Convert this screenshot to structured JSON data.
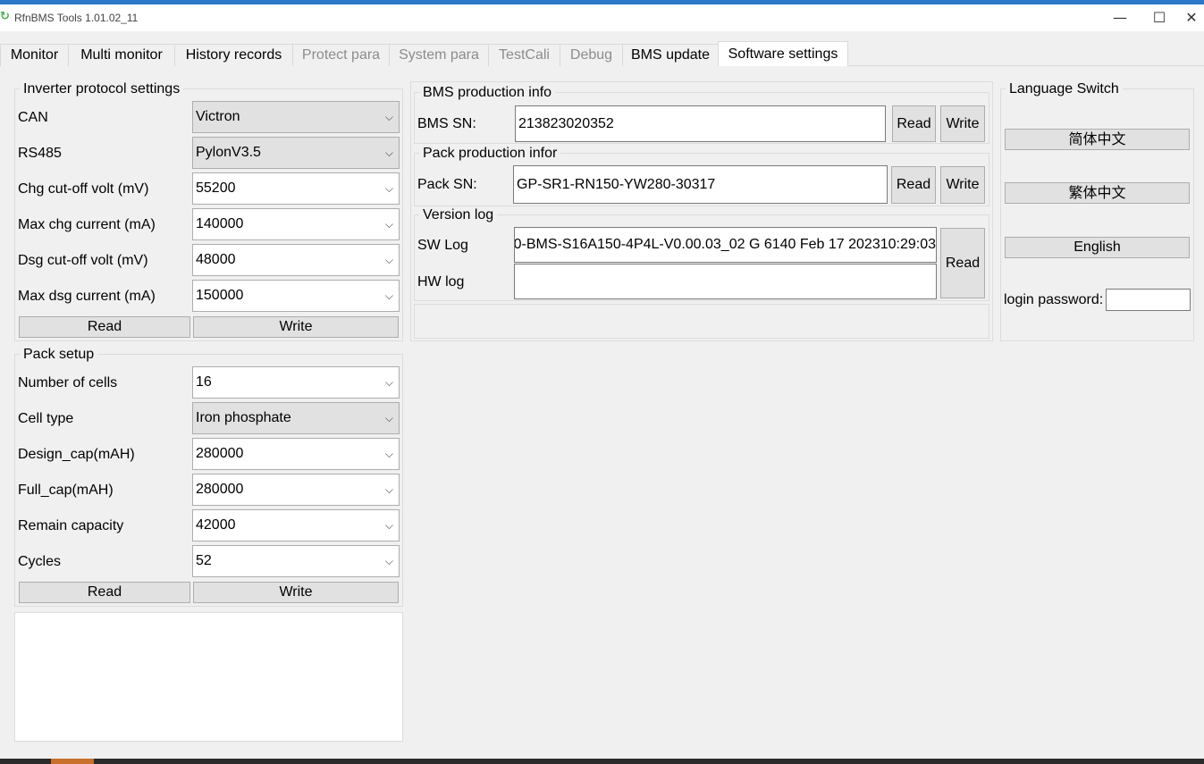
{
  "window": {
    "title": "RfnBMS Tools 1.01.02_11",
    "min": "—",
    "max": "☐",
    "close": "✕"
  },
  "tabs": [
    {
      "label": "Monitor",
      "state": "normal"
    },
    {
      "label": "Multi monitor",
      "state": "normal"
    },
    {
      "label": "History records",
      "state": "normal"
    },
    {
      "label": "Protect para",
      "state": "disabled"
    },
    {
      "label": "System para",
      "state": "disabled"
    },
    {
      "label": "TestCali",
      "state": "disabled"
    },
    {
      "label": "Debug",
      "state": "disabled"
    },
    {
      "label": "BMS update",
      "state": "normal"
    },
    {
      "label": "Software settings",
      "state": "active"
    }
  ],
  "inverter": {
    "title": "Inverter protocol settings",
    "rows": [
      {
        "label": "CAN",
        "value": "Victron"
      },
      {
        "label": "RS485",
        "value": "PylonV3.5"
      },
      {
        "label": "Chg cut-off volt (mV)",
        "value": "55200"
      },
      {
        "label": "Max chg current (mA)",
        "value": "140000"
      },
      {
        "label": "Dsg cut-off volt (mV)",
        "value": "48000"
      },
      {
        "label": "Max dsg current (mA)",
        "value": "150000"
      }
    ],
    "read": "Read",
    "write": "Write"
  },
  "pack_setup": {
    "title": "Pack setup",
    "rows": [
      {
        "label": "Number of cells",
        "value": "16"
      },
      {
        "label": "Cell type",
        "value": "Iron phosphate"
      },
      {
        "label": "Design_cap(mAH)",
        "value": "280000"
      },
      {
        "label": "Full_cap(mAH)",
        "value": "280000"
      },
      {
        "label": "Remain capacity",
        "value": "42000"
      },
      {
        "label": "Cycles",
        "value": "52"
      }
    ],
    "read": "Read",
    "write": "Write"
  },
  "bms_info": {
    "title": "BMS production info",
    "sn_label": "BMS SN:",
    "sn_value": "213823020352",
    "read": "Read",
    "write": "Write"
  },
  "pack_info": {
    "title": "Pack production infor",
    "sn_label": "Pack SN:",
    "sn_value": "GP-SR1-RN150-YW280-30317",
    "read": "Read",
    "write": "Write"
  },
  "version_log": {
    "title": "Version log",
    "sw_label": "SW Log",
    "sw_value": "0-BMS-S16A150-4P4L-V0.00.03_02 G 6140 Feb 17 202310:29:03",
    "hw_label": "HW log",
    "hw_value": "",
    "read": "Read"
  },
  "language": {
    "title": "Language Switch",
    "simplified": "简体中文",
    "traditional": "繁体中文",
    "english": "English",
    "password_label": "login password:",
    "password_value": ""
  },
  "colors": {
    "accent": "#2b79c9",
    "button": "#e1e1e1",
    "tab_active": "#ffffff"
  },
  "icons": {
    "app": "rfn-logo-icon",
    "combo": "chevron-down-icon"
  }
}
